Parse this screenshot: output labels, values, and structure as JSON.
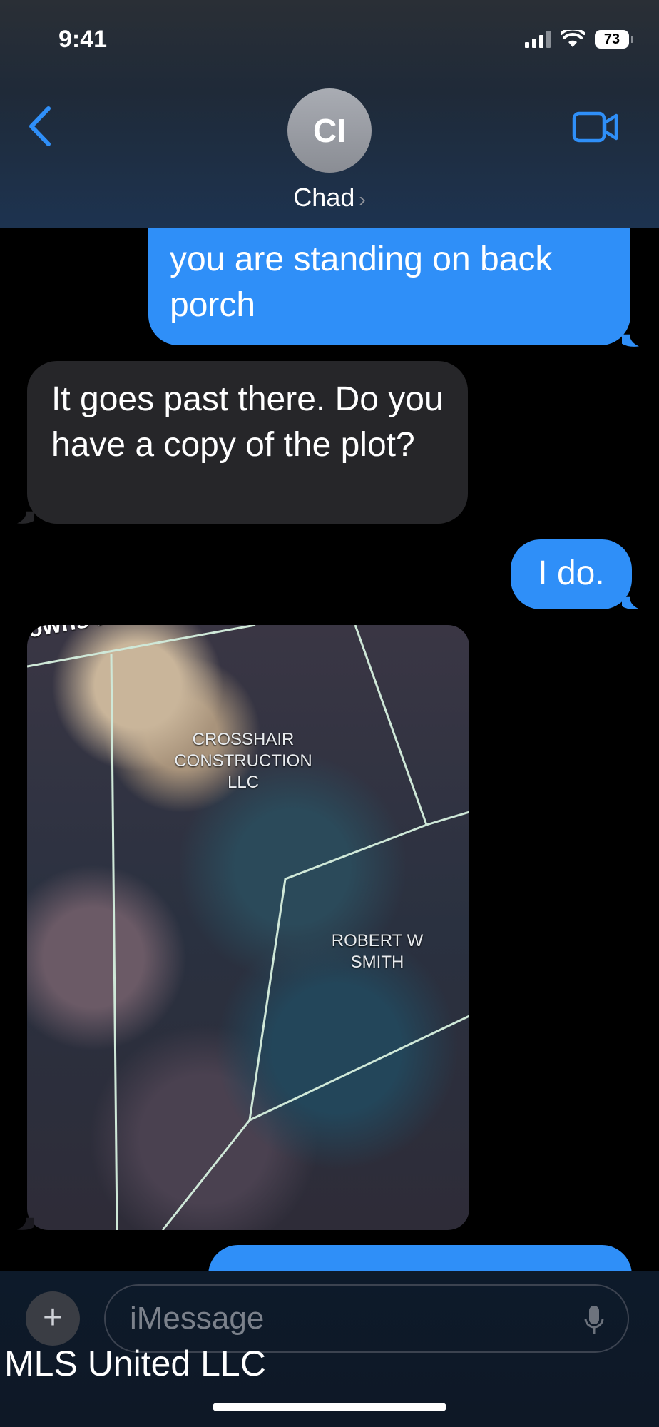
{
  "status_bar": {
    "time": "9:41",
    "battery": "73"
  },
  "header": {
    "avatar_initials": "CI",
    "contact_name": "Chad",
    "chevron": "›"
  },
  "messages": [
    {
      "type": "sent",
      "text": "you are standing on back porch"
    },
    {
      "type": "received",
      "text": "It goes past there. Do you have a copy of the plot?"
    },
    {
      "type": "sent",
      "text": "I do."
    }
  ],
  "image_message": {
    "road_label": "owns Ferry",
    "parcels": [
      "CROSSHAIR CONSTRUCTION LLC",
      "ROBERT W SMITH"
    ]
  },
  "composer": {
    "placeholder": "iMessage",
    "plus": "+"
  },
  "watermark": "MLS United LLC",
  "colors": {
    "sent_bubble": "#2f8ff8",
    "received_bubble": "#262629",
    "accent": "#2f8ff8"
  },
  "icons": [
    "back-chevron-icon",
    "video-camera-icon",
    "mic-icon",
    "plus-icon",
    "signal-icon",
    "wifi-icon",
    "battery-icon"
  ]
}
